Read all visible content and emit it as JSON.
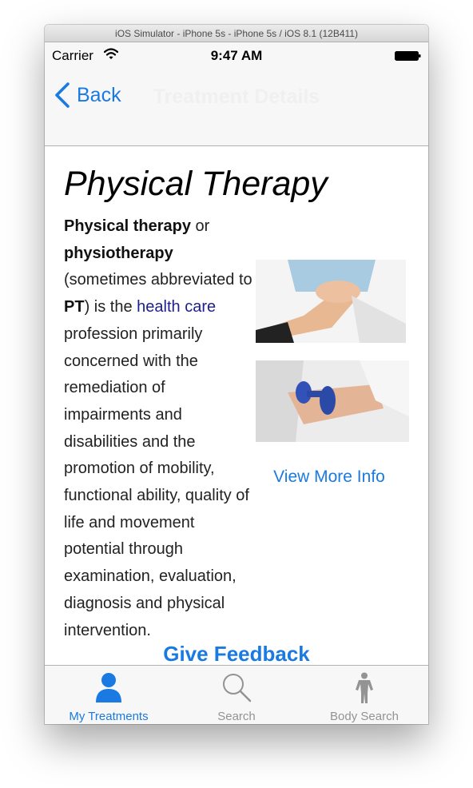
{
  "window": {
    "title": "iOS Simulator - iPhone 5s - iPhone 5s / iOS 8.1 (12B411)"
  },
  "status_bar": {
    "carrier": "Carrier",
    "time": "9:47 AM"
  },
  "nav": {
    "back_label": "Back",
    "title": "Treatment Details"
  },
  "article": {
    "title": "Physical Therapy",
    "bold_1": "Physical therapy",
    "text_1": " or ",
    "bold_2": "physiotherapy",
    "text_2": " (sometimes abbreviated to ",
    "bold_3": "PT",
    "text_3": ") is the ",
    "link": "health care",
    "text_4": " profession primarily concerned with the remediation of impairments and disabilities and the promotion of mobility, functional ability, quality of life and movement potential through examination, evaluation, diagnosis and physical intervention."
  },
  "more_info_label": "View More Info",
  "feedback_label": "Give Feedback",
  "tabs": [
    {
      "label": "My Treatments",
      "icon": "person-icon"
    },
    {
      "label": "Search",
      "icon": "search-icon"
    },
    {
      "label": "Body Search",
      "icon": "body-figure-icon"
    }
  ],
  "colors": {
    "accent": "#1a7ae2",
    "inactive": "#939393",
    "link": "#1e1e8c"
  }
}
